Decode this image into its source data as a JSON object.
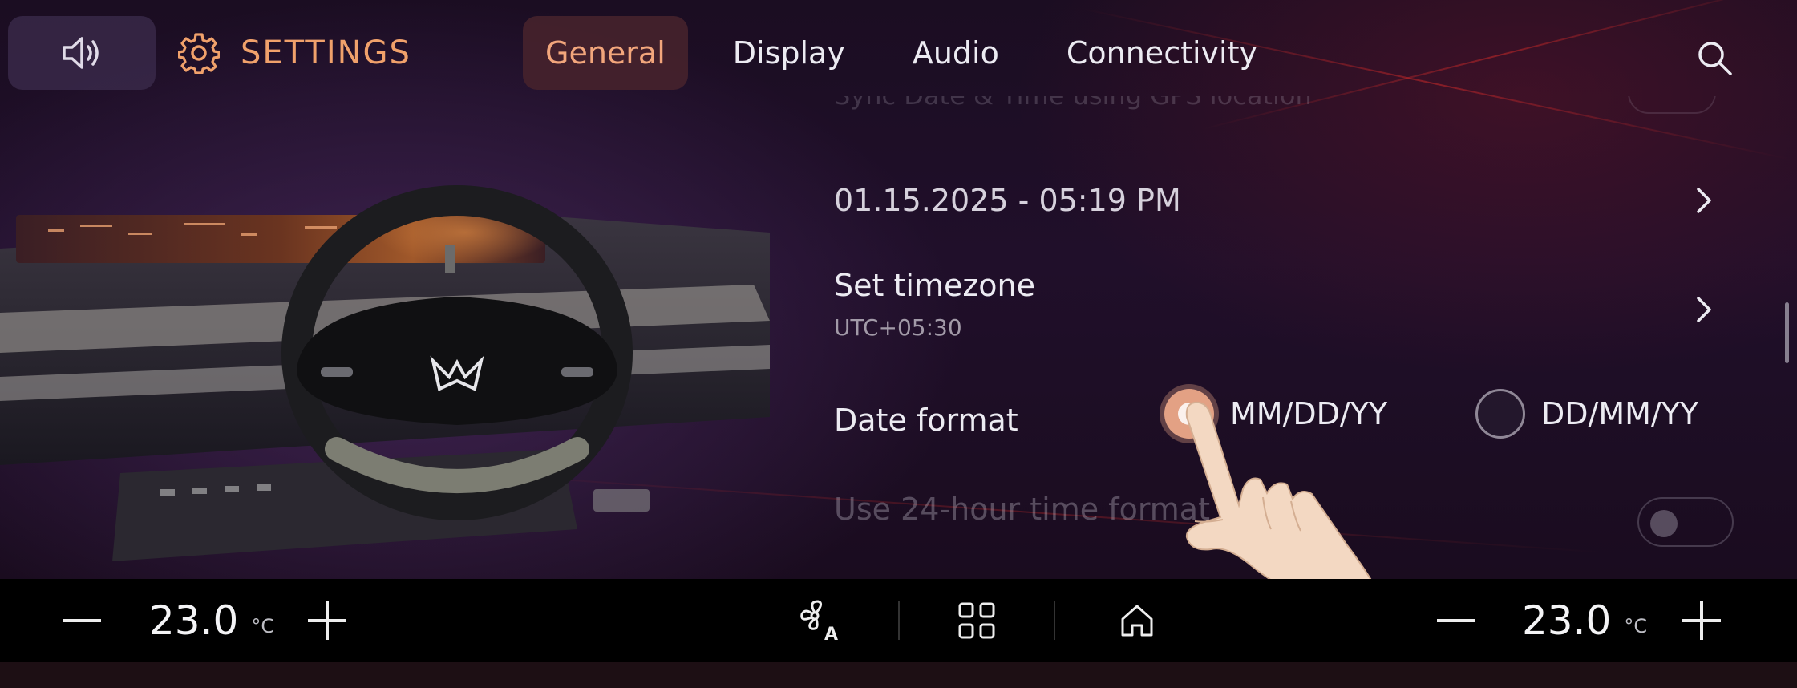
{
  "header": {
    "title": "SETTINGS",
    "tabs": [
      {
        "label": "General",
        "active": true
      },
      {
        "label": "Display",
        "active": false
      },
      {
        "label": "Audio",
        "active": false
      },
      {
        "label": "Connectivity",
        "active": false
      }
    ]
  },
  "settings": {
    "faded_top_label": "Sync Date & Time using GPS location",
    "datetime": "01.15.2025 - 05:19 PM",
    "timezone": {
      "title": "Set timezone",
      "value": "UTC+05:30"
    },
    "date_format": {
      "label": "Date format",
      "options": [
        {
          "label": "MM/DD/YY",
          "selected": true
        },
        {
          "label": "DD/MM/YY",
          "selected": false
        }
      ]
    },
    "time_format": {
      "label": "Use 24-hour time format",
      "enabled": false
    }
  },
  "climate": {
    "left_temp": "23.0",
    "right_temp": "23.0",
    "unit": "°C"
  },
  "colors": {
    "accent": "#f0a16b",
    "active_tab_bg": "#46222c",
    "background": "#1b0d22"
  },
  "icons": [
    "volume-icon",
    "gear-icon",
    "search-icon",
    "chevron-right-icon",
    "fan-auto-icon",
    "apps-grid-icon",
    "home-icon",
    "minus-icon",
    "plus-icon"
  ]
}
